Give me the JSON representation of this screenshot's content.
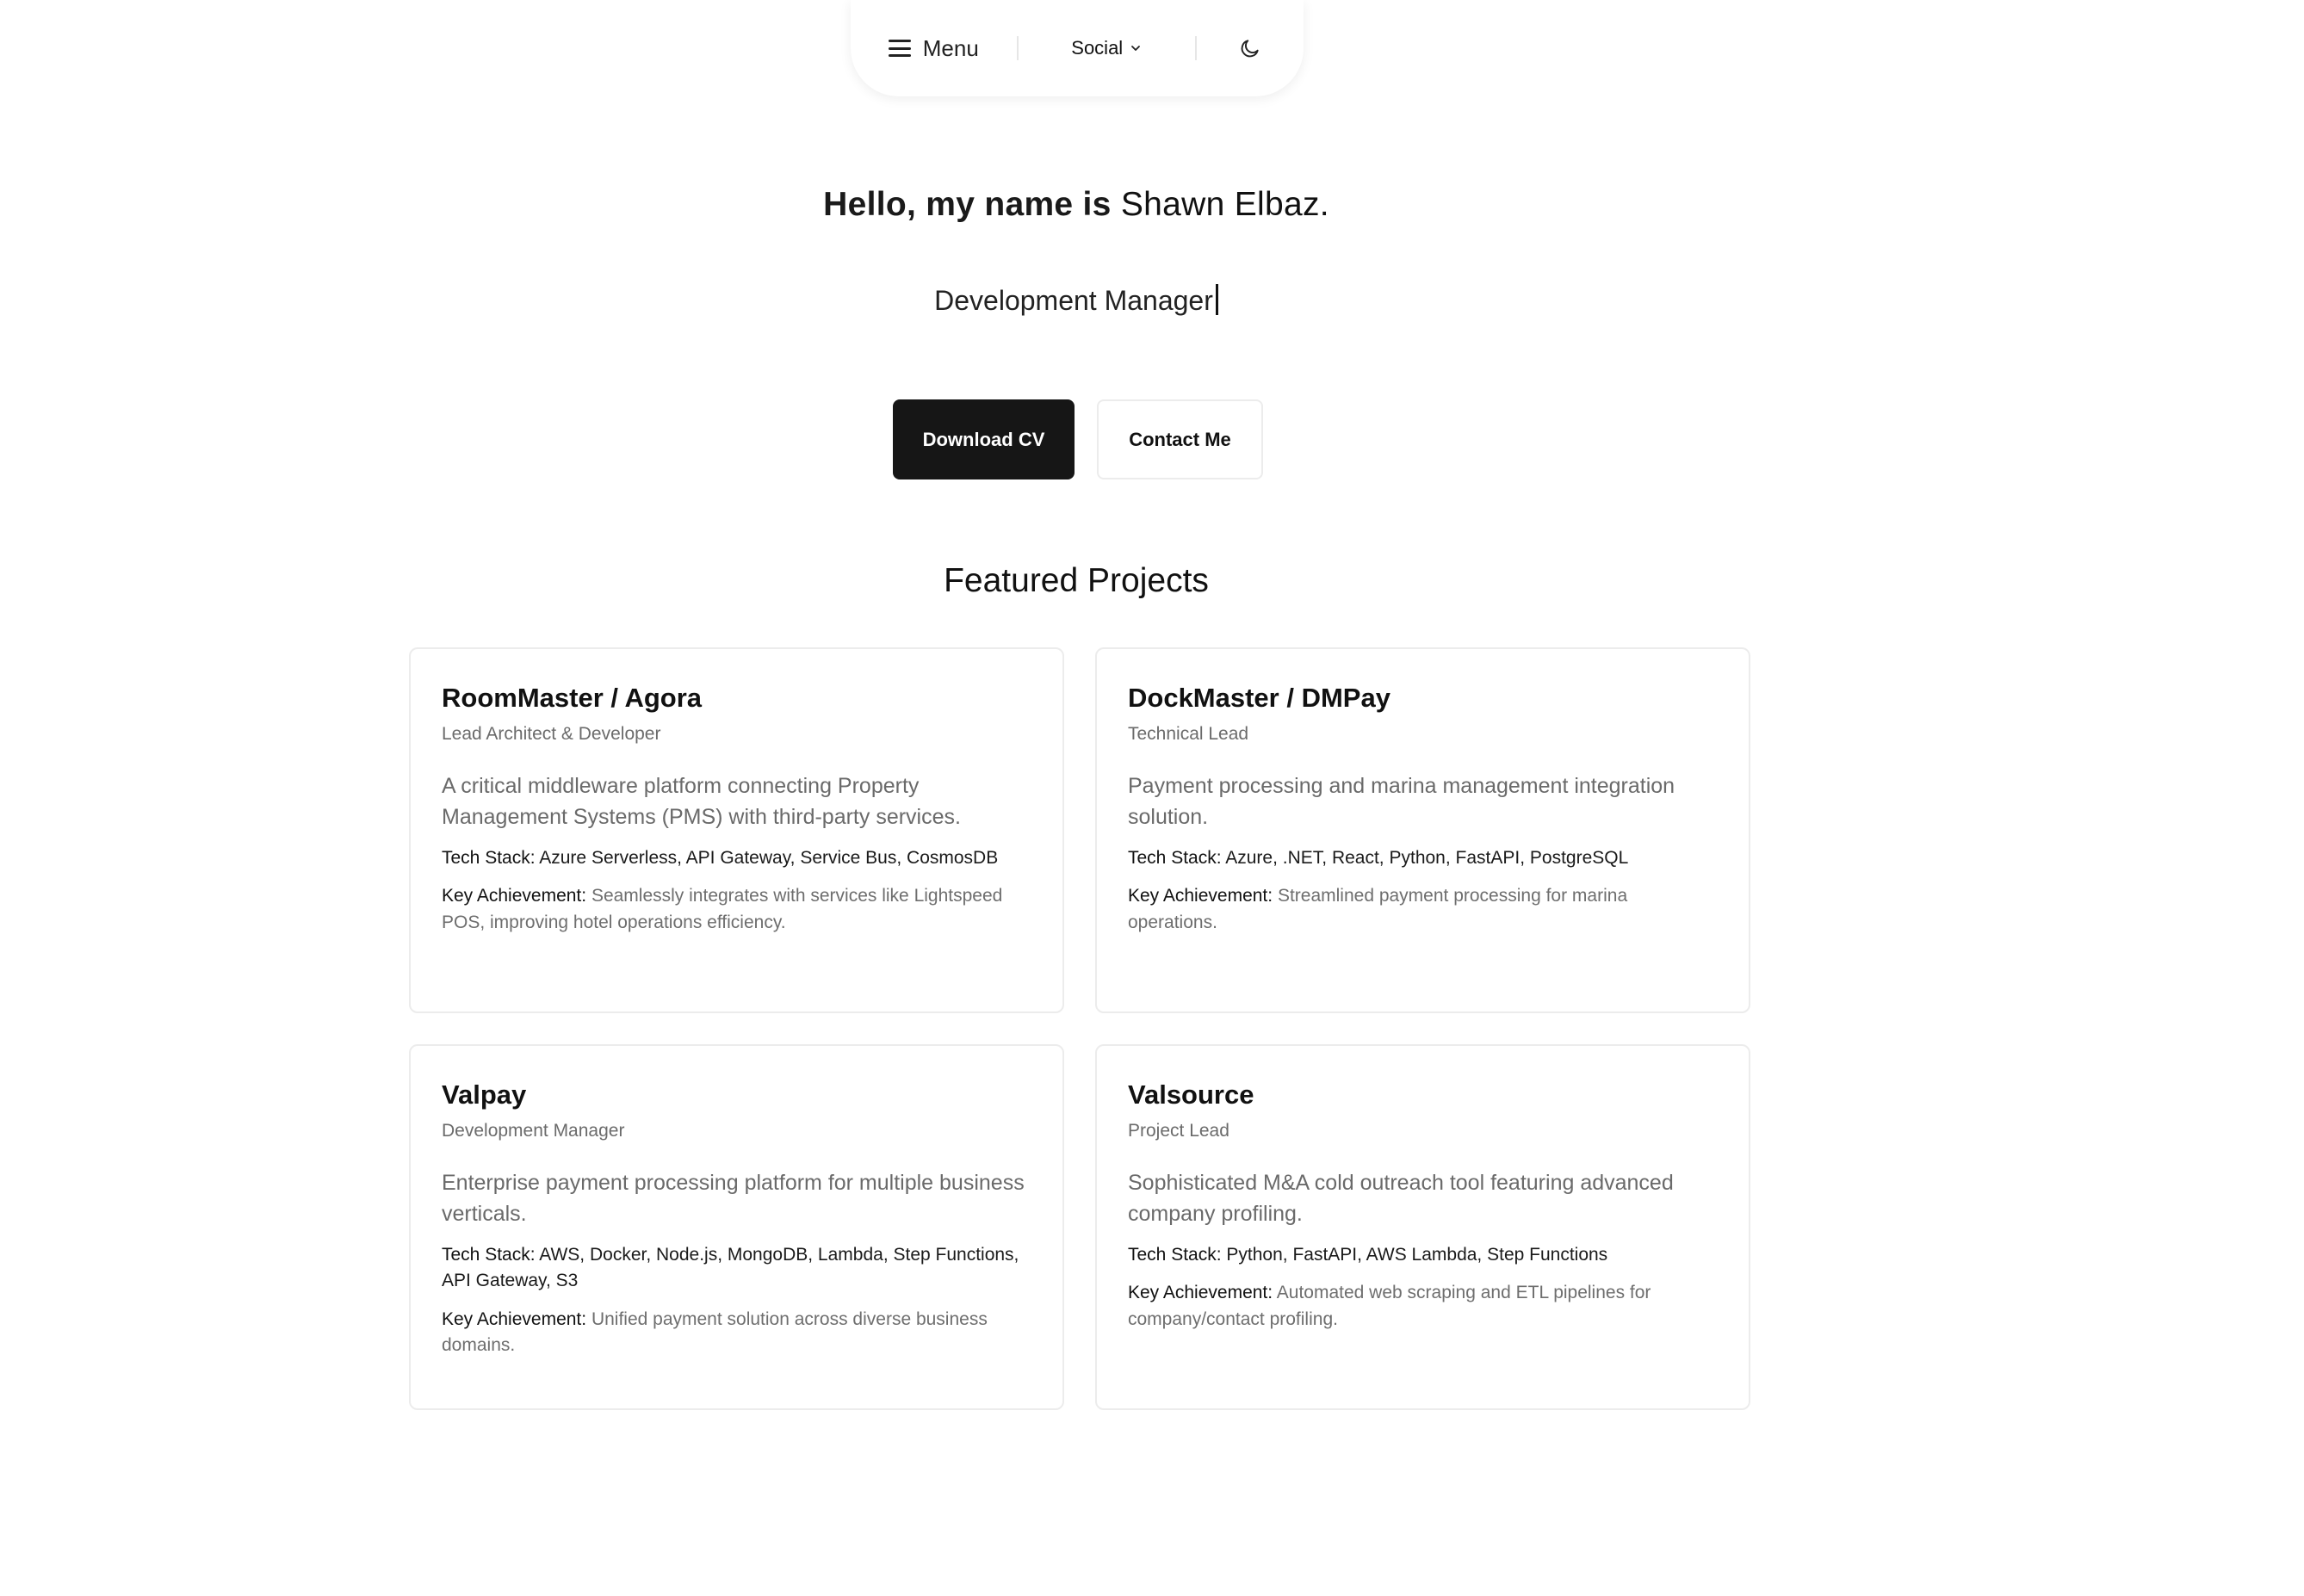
{
  "nav": {
    "menu_label": "Menu",
    "social_label": "Social",
    "menu_icon": "hamburger-icon",
    "social_icon": "chevron-down-icon",
    "theme_icon": "moon-icon"
  },
  "hero": {
    "greeting": "Hello, my name is",
    "name": "Shawn Elbaz.",
    "role": "Development Manager"
  },
  "buttons": {
    "download_cv": "Download CV",
    "contact_me": "Contact Me"
  },
  "projects": {
    "title": "Featured Projects",
    "tech_label": "Tech Stack:",
    "achievement_label": "Key Achievement:",
    "items": [
      {
        "title": "RoomMaster / Agora",
        "role": "Lead Architect & Developer",
        "description": "A critical middleware platform connecting Property Management Systems (PMS) with third-party services.",
        "tech_stack": "Azure Serverless, API Gateway, Service Bus, CosmosDB",
        "achievement": "Seamlessly integrates with services like Lightspeed POS, improving hotel operations efficiency."
      },
      {
        "title": "DockMaster / DMPay",
        "role": "Technical Lead",
        "description": "Payment processing and marina management integration solution.",
        "tech_stack": "Azure, .NET, React, Python, FastAPI, PostgreSQL",
        "achievement": "Streamlined payment processing for marina operations."
      },
      {
        "title": "Valpay",
        "role": "Development Manager",
        "description": "Enterprise payment processing platform for multiple business verticals.",
        "tech_stack": "AWS, Docker, Node.js, MongoDB, Lambda, Step Functions, API Gateway, S3",
        "achievement": "Unified payment solution across diverse business domains."
      },
      {
        "title": "Valsource",
        "role": "Project Lead",
        "description": "Sophisticated M&A cold outreach tool featuring advanced company profiling.",
        "tech_stack": "Python, FastAPI, AWS Lambda, Step Functions",
        "achievement": "Automated web scraping and ETL pipelines for company/contact profiling."
      }
    ]
  }
}
